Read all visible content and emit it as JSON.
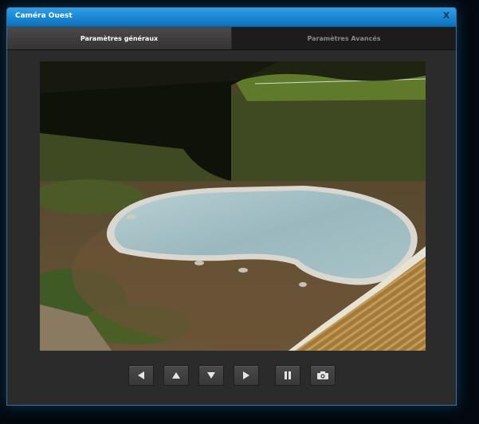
{
  "window": {
    "title": "Caméra Ouest",
    "close_label": "X"
  },
  "tabs": [
    {
      "label": "Paramètres généraux",
      "active": true
    },
    {
      "label": "Paramètres Avancés",
      "active": false
    }
  ],
  "controls": [
    {
      "icon": "arrow-left-icon"
    },
    {
      "icon": "arrow-up-icon"
    },
    {
      "icon": "arrow-down-icon"
    },
    {
      "icon": "arrow-right-icon"
    },
    {
      "icon": "pause-icon"
    },
    {
      "icon": "camera-icon"
    }
  ],
  "colors": {
    "titlebar": "#1a86d2",
    "panel": "#2b2b2b",
    "glow": "#145a96"
  }
}
